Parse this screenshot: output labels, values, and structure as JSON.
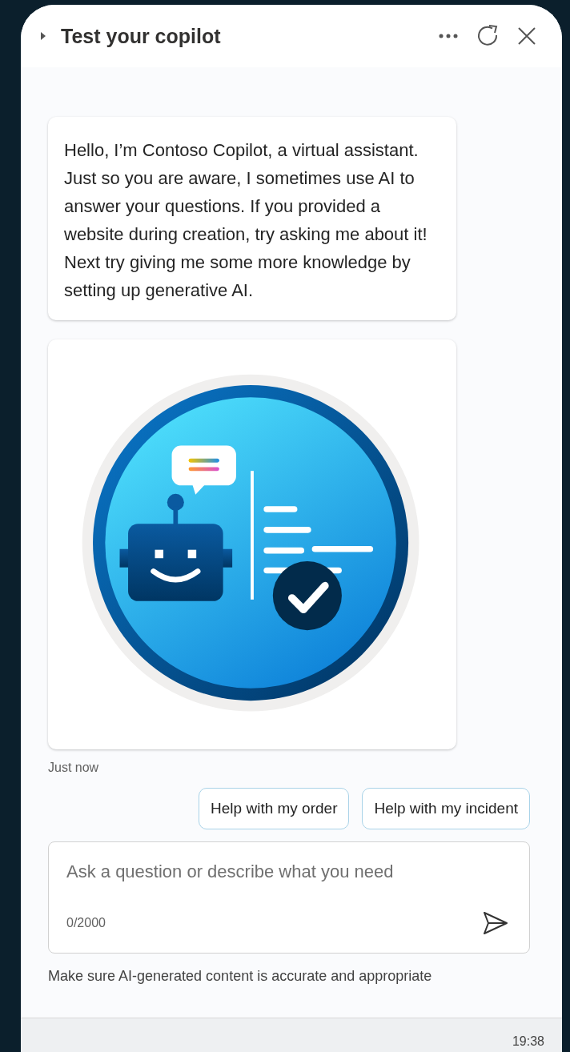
{
  "header": {
    "title": "Test your copilot"
  },
  "messages": [
    {
      "kind": "text",
      "text": "Hello, I’m Contoso Copilot, a virtual assistant. Just so you are aware, I sometimes use AI to answer your questions. If you provided a website during creation, try asking me about it! Next try giving me some more knowledge by setting up generative AI."
    },
    {
      "kind": "image"
    }
  ],
  "timestamp": "Just now",
  "suggestions": [
    "Help with my order",
    "Help with my incident"
  ],
  "composer": {
    "placeholder": "Ask a question or describe what you need",
    "counter": "0/2000"
  },
  "disclaimer": "Make sure AI-generated content is accurate and appropriate",
  "taskbar": {
    "time": "19:38"
  }
}
